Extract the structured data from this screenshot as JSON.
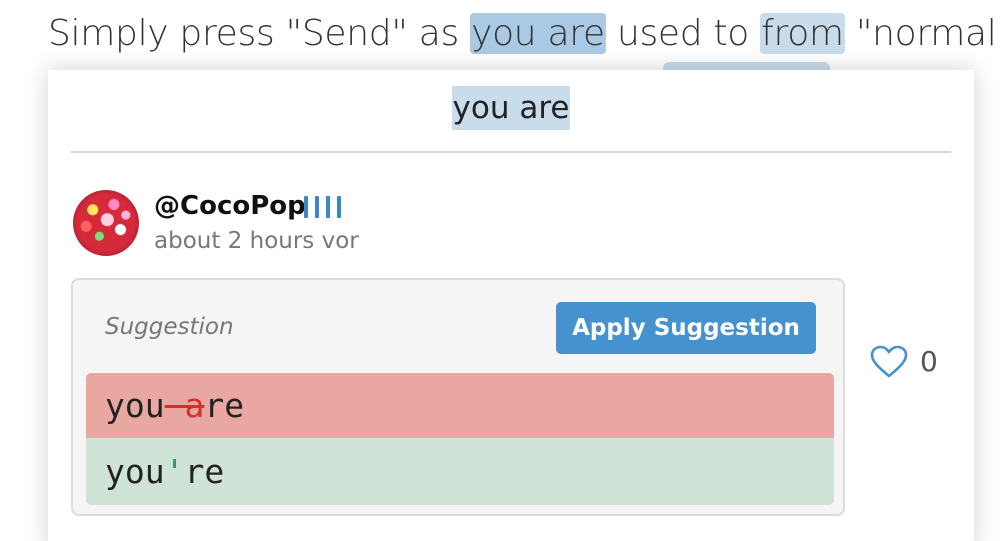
{
  "sentence": {
    "part1": "Simply press \"Send\" as ",
    "highlight1": "you are",
    "part2": " used to ",
    "highlight2": "from",
    "part3": " \"normal\""
  },
  "card": {
    "title": "you are"
  },
  "comment": {
    "username": "@CocoPop",
    "rank_bars": 4,
    "timestamp": "about 2 hours vor",
    "like_count": "0"
  },
  "suggestion": {
    "label": "Suggestion",
    "apply_label": "Apply Suggestion",
    "old": {
      "before": "you",
      "removed": " a",
      "after": "re"
    },
    "new": {
      "before": "you",
      "added": "'",
      "after": "re"
    }
  },
  "colors": {
    "highlight": "#a9c9e4",
    "highlight_light": "#c9dceb",
    "accent": "#4692ce",
    "rank": "#3b86c6",
    "diff_removed_bg": "#e9a7a2",
    "diff_removed_text": "#d0312a",
    "diff_added_bg": "#cfe3d6",
    "diff_added_text": "#2e9a4a"
  },
  "icons": {
    "avatar": "avatar",
    "like": "heart-outline-icon",
    "rank": "rank-bars-icon"
  }
}
